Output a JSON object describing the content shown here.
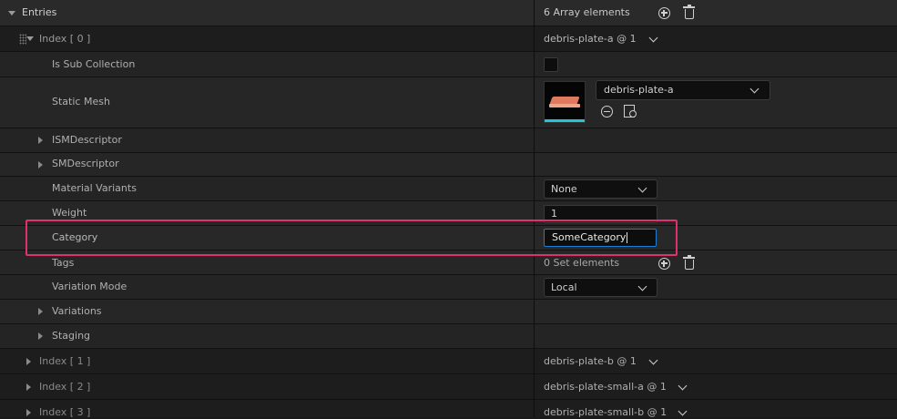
{
  "entries": {
    "label": "Entries",
    "count_text": "6 Array elements"
  },
  "index0": {
    "label": "Index [ 0 ]",
    "value": "debris-plate-a @ 1",
    "properties": {
      "is_sub_collection": {
        "label": "Is Sub Collection",
        "checked": false
      },
      "static_mesh": {
        "label": "Static Mesh",
        "value": "debris-plate-a"
      },
      "ism_descriptor": {
        "label": "ISMDescriptor"
      },
      "sm_descriptor": {
        "label": "SMDescriptor"
      },
      "material_variants": {
        "label": "Material Variants",
        "value": "None"
      },
      "weight": {
        "label": "Weight",
        "value": "1"
      },
      "category": {
        "label": "Category",
        "value": "SomeCategory"
      },
      "tags": {
        "label": "Tags",
        "count_text": "0 Set elements"
      },
      "variation_mode": {
        "label": "Variation Mode",
        "value": "Local"
      },
      "variations": {
        "label": "Variations"
      },
      "staging": {
        "label": "Staging"
      }
    }
  },
  "collapsed_entries": [
    {
      "label": "Index [ 1 ]",
      "value": "debris-plate-b @ 1"
    },
    {
      "label": "Index [ 2 ]",
      "value": "debris-plate-small-a @ 1"
    },
    {
      "label": "Index [ 3 ]",
      "value": "debris-plate-small-b @ 1"
    }
  ],
  "colors": {
    "highlight": "#e0306f",
    "focus_border": "#1c7fd6",
    "thumbnail_accent": "#1fc8d8"
  }
}
